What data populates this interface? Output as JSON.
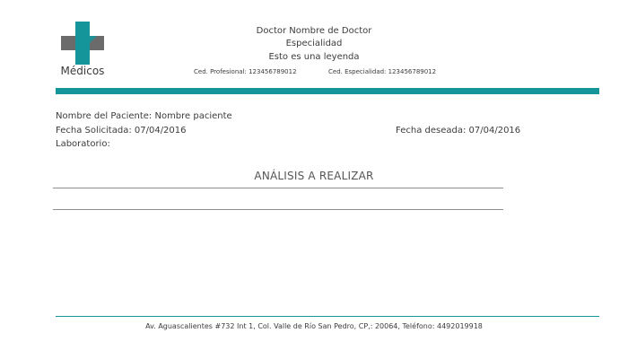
{
  "brand": {
    "logo_text": "Médicos",
    "accent": "#14959a",
    "cross_dark": "#6b6b6b"
  },
  "doctor": {
    "name": "Doctor Nombre de Doctor",
    "specialty": "Especialidad",
    "legend": "Esto es una leyenda",
    "ced_profesional": "Ced. Profesional: 123456789012",
    "ced_especialidad": "Ced. Especialidad: 123456789012"
  },
  "patient": {
    "name_line": "Nombre del Paciente: Nombre paciente",
    "requested_line": "Fecha Solicitada: 07/04/2016",
    "lab_line": "Laboratorio:",
    "desired_line": "Fecha deseada: 07/04/2016"
  },
  "section": {
    "title": "ANÁLISIS A REALIZAR"
  },
  "footer": {
    "address": "Av. Aguascalientes #732 Int 1, Col. Valle de Río San Pedro, CP,: 20064, Teléfono: 4492019918"
  }
}
